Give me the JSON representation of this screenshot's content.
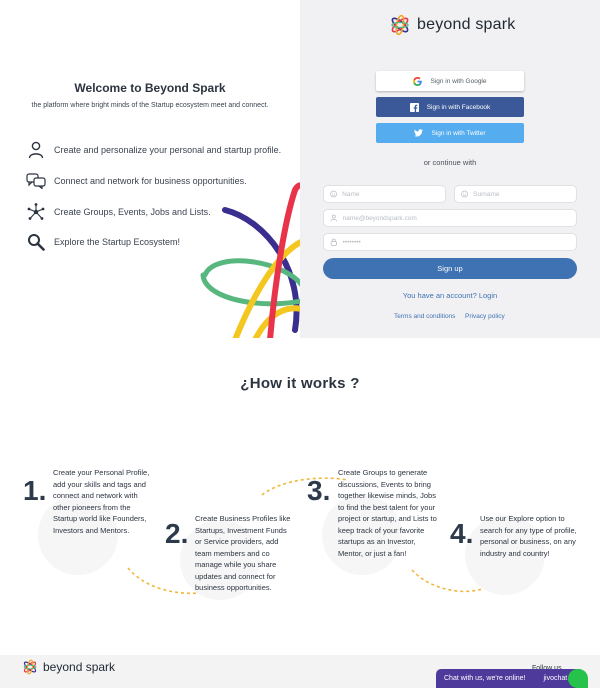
{
  "hero": {
    "title": "Welcome to Beyond Spark",
    "subtitle": "the platform where bright minds of the Startup ecosystem meet and connect.",
    "features": [
      {
        "icon": "person-icon",
        "text": "Create and personalize your personal and startup profile."
      },
      {
        "icon": "chat-bubbles-icon",
        "text": "Connect and network for business opportunities."
      },
      {
        "icon": "network-nodes-icon",
        "text": "Create Groups, Events, Jobs and Lists."
      },
      {
        "icon": "magnifier-icon",
        "text": "Explore the Startup Ecosystem!"
      }
    ]
  },
  "auth": {
    "brand": "beyond spark",
    "google_label": "Sign in with Google",
    "facebook_label": "Sign in with Facebook",
    "twitter_label": "Sign in with Twitter",
    "or_text": "or continue with",
    "name_placeholder": "Name",
    "surname_placeholder": "Surname",
    "email_placeholder": "name@beyondspark.com",
    "password_placeholder": "••••••••",
    "signup_label": "Sign up",
    "login_text": "You have an account? Login",
    "terms": "Terms and conditions",
    "privacy": "Privacy policy"
  },
  "how": {
    "title": "¿How it works ?",
    "steps": [
      {
        "num": "1.",
        "text": "Create your Personal Profile, add your skills and tags and connect and network with other pioneers from the Startup world like Founders, Investors and Mentors."
      },
      {
        "num": "2.",
        "text": "Create Business Profiles like Startups, Investment Funds or Service providers, add team members and co manage while you share updates and connect for business opportunities."
      },
      {
        "num": "3.",
        "text": "Create Groups to generate discussions, Events to bring together likewise minds, Jobs to find the best talent for your project or startup, and Lists to keep track of your favorite startups as an Investor, Mentor, or just a fan!"
      },
      {
        "num": "4.",
        "text": "Use our Explore option to search for any type of profile, personal or business, on any industry and country!"
      }
    ]
  },
  "footer": {
    "brand": "beyond spark",
    "follow": "Follow us",
    "chat_text": "Chat with us, we're online!",
    "chat_brand": "jivochat"
  },
  "colors": {
    "accent": "#3f72b3",
    "facebook": "#3b5998",
    "twitter": "#55acee",
    "dashes": "#f0b73a",
    "chat": "#4d3a9a"
  }
}
